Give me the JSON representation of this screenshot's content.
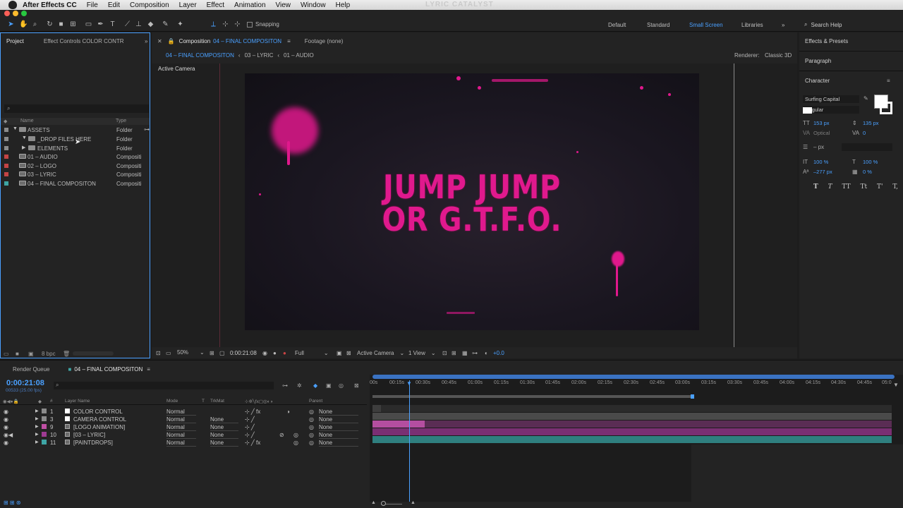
{
  "menubar": {
    "app_name": "After Effects CC",
    "items": [
      "File",
      "Edit",
      "Composition",
      "Layer",
      "Effect",
      "Animation",
      "View",
      "Window",
      "Help"
    ],
    "watermark": "LYRIC CATALYST"
  },
  "toolbar": {
    "snapping_label": "Snapping",
    "workspaces": [
      "Default",
      "Standard",
      "Small Screen",
      "Libraries"
    ],
    "active_workspace": "Small Screen",
    "search_placeholder": "Search Help"
  },
  "project": {
    "tabs": [
      "Project",
      "Effect Controls COLOR CONTR"
    ],
    "col_name": "Name",
    "col_type": "Type",
    "items": [
      {
        "name": "ASSETS",
        "type": "Folder",
        "label_color": "#8b8b8b"
      },
      {
        "name": "_DROP FILES HERE",
        "type": "Folder",
        "label_color": "#8b8b8b"
      },
      {
        "name": "ELEMENTS",
        "type": "Folder",
        "label_color": "#8b8b8b"
      },
      {
        "name": "01 – AUDIO",
        "type": "Compositi",
        "label_color": "#c44444"
      },
      {
        "name": "02 – LOGO",
        "type": "Compositi",
        "label_color": "#c44444"
      },
      {
        "name": "03 – LYRIC",
        "type": "Compositi",
        "label_color": "#c44444"
      },
      {
        "name": "04 – FINAL COMPOSITON",
        "type": "Compositi",
        "label_color": "#3ea5a5"
      }
    ],
    "bpc": "8 bpc"
  },
  "comp": {
    "tab_prefix": "Composition",
    "tab_name": "04 – FINAL COMPOSITON",
    "footage_tab": "Footage (none)",
    "crumbs": [
      "04 – FINAL COMPOSITON",
      "03 – LYRIC",
      "01 – AUDIO"
    ],
    "renderer_label": "Renderer:",
    "renderer": "Classic 3D",
    "view_label": "Active Camera",
    "lyric_line1": "JUMP JUMP",
    "lyric_line2": "OR G.T.F.O.",
    "zoom": "50%",
    "timecode": "0:00:21:08",
    "resolution": "Full",
    "camera": "Active Camera",
    "views": "1 View",
    "exposure": "+0.0"
  },
  "right": {
    "effects": "Effects & Presets",
    "paragraph": "Paragraph",
    "character": "Character",
    "font": "Surfing Capital",
    "style": "Regular",
    "size": "153 px",
    "leading": "135 px",
    "kerning": "Optical",
    "tracking": "0",
    "stroke": "– px",
    "vscale": "100 %",
    "hscale": "100 %",
    "baseline": "–277 px",
    "tsume": "0 %",
    "styles": [
      "T",
      "T",
      "TT",
      "Tt",
      "T'",
      "T,"
    ]
  },
  "timeline": {
    "render_queue": "Render Queue",
    "comp_tab": "04 – FINAL COMPOSITON",
    "timecode": "0:00:21:08",
    "frames": "00533 (25.00 fps)",
    "col_num": "#",
    "col_layer": "Layer Name",
    "col_mode": "Mode",
    "col_t": "T",
    "col_trkmat": "TrkMat",
    "col_parent": "Parent",
    "layers": [
      {
        "num": "1",
        "name": "COLOR CONTROL",
        "mode": "Normal",
        "trkmat": "",
        "parent": "None",
        "color": "#8b8b8b",
        "swatch": "#ffffff"
      },
      {
        "num": "3",
        "name": "CAMERA CONTROL",
        "mode": "Normal",
        "trkmat": "None",
        "parent": "None",
        "color": "#8b8b8b",
        "swatch": "#ffffff"
      },
      {
        "num": "9",
        "name": "[LOGO ANIMATION]",
        "mode": "Normal",
        "trkmat": "None",
        "parent": "None",
        "color": "#c04fa4",
        "swatch": "#c04fa4"
      },
      {
        "num": "10",
        "name": "[03 – LYRIC]",
        "mode": "Normal",
        "trkmat": "None",
        "parent": "None",
        "color": "#9e3b93",
        "swatch": "#9e3b93"
      },
      {
        "num": "11",
        "name": "[PAINTDROPS]",
        "mode": "Normal",
        "trkmat": "None",
        "parent": "None",
        "color": "#3ea5a5",
        "swatch": "#3ea5a5"
      }
    ],
    "ticks": [
      "00s",
      "00:15s",
      "00:30s",
      "00:45s",
      "01:00s",
      "01:15s",
      "01:30s",
      "01:45s",
      "02:00s",
      "02:15s",
      "02:30s",
      "02:45s",
      "03:00s",
      "03:15s",
      "03:30s",
      "03:45s",
      "04:00s",
      "04:15s",
      "04:30s",
      "04:45s",
      "05:0"
    ]
  }
}
